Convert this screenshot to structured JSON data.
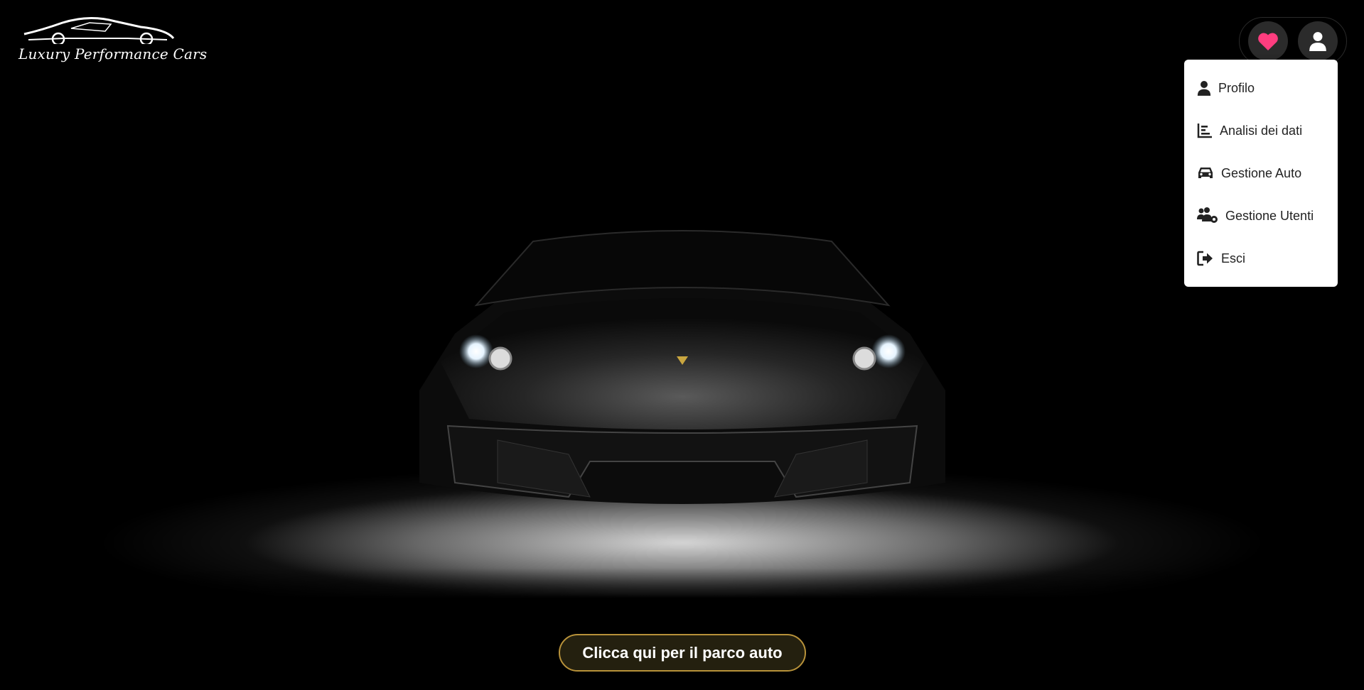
{
  "brand": {
    "name": "Luxury Performance Cars"
  },
  "header": {
    "favorites_icon": "heart-icon",
    "account_icon": "user-icon",
    "accent_color": "#ff3d7f"
  },
  "dropdown": {
    "items": [
      {
        "label": "Profilo",
        "icon": "user-icon"
      },
      {
        "label": "Analisi dei dati",
        "icon": "bar-chart-icon"
      },
      {
        "label": "Gestione Auto",
        "icon": "car-icon"
      },
      {
        "label": "Gestione Utenti",
        "icon": "users-cog-icon"
      },
      {
        "label": "Esci",
        "icon": "logout-icon"
      }
    ]
  },
  "hero": {
    "cta_label": "Clicca qui per il parco auto",
    "cta_border_color": "#b8923a"
  }
}
